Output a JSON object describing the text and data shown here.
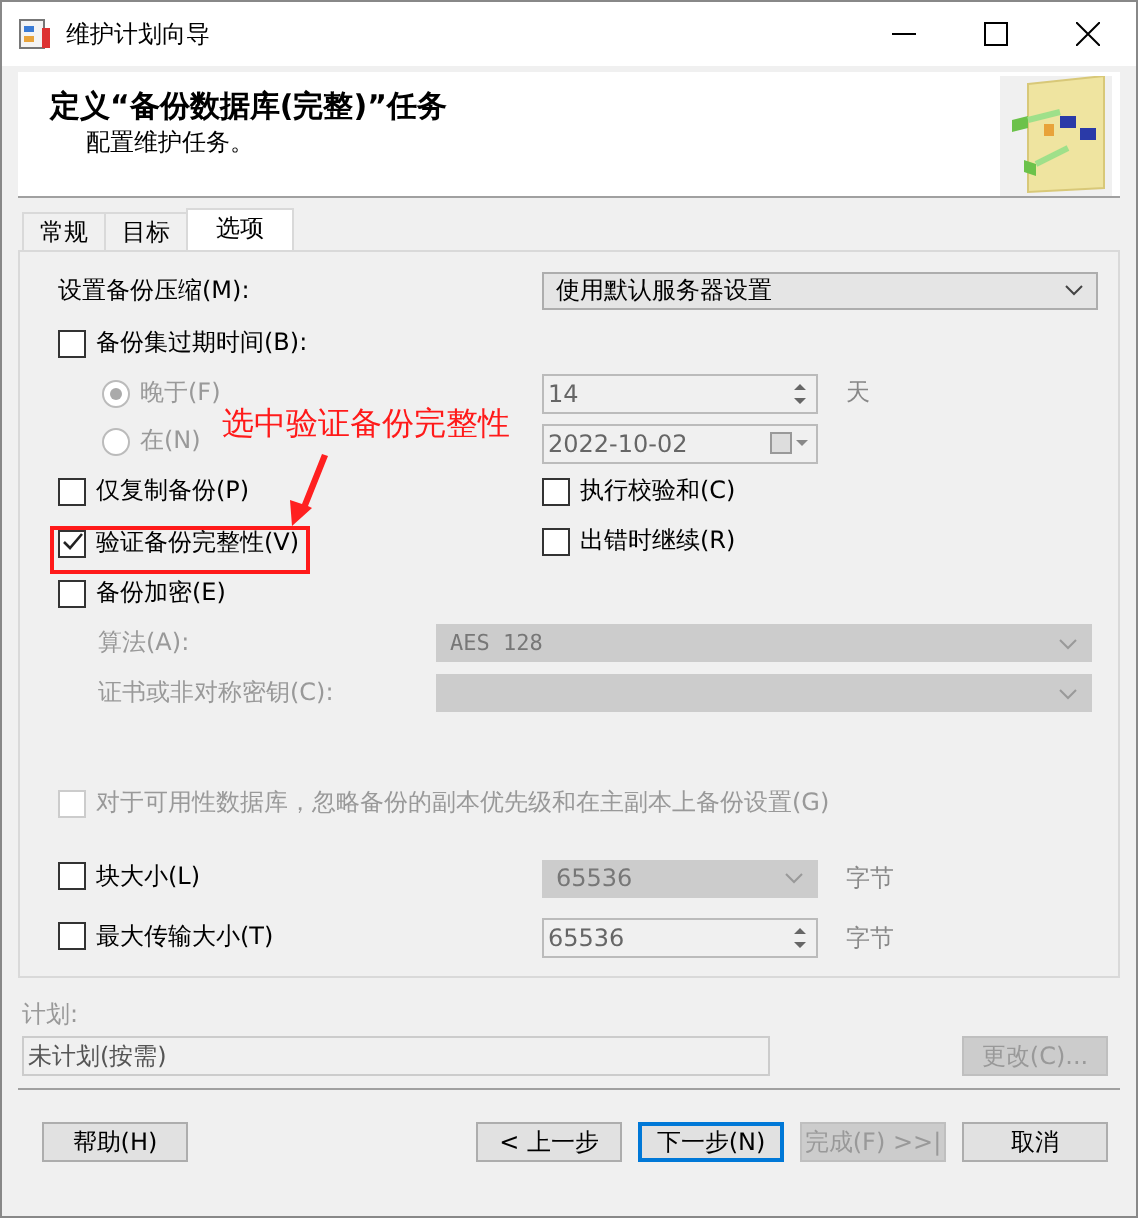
{
  "window": {
    "title": "维护计划向导"
  },
  "header": {
    "title": "定义“备份数据库(完整)”任务",
    "subtitle": "配置维护任务。"
  },
  "tabs": [
    {
      "label": "常规",
      "selected": false
    },
    {
      "label": "目标",
      "selected": false
    },
    {
      "label": "选项",
      "selected": true
    }
  ],
  "compression": {
    "label": "设置备份压缩(M):",
    "value": "使用默认服务器设置"
  },
  "expire": {
    "label": "备份集过期时间(B):",
    "checked": false
  },
  "expire_options": [
    {
      "label": "晚于(F)",
      "selected": true,
      "disabled": true,
      "field": {
        "kind": "spin",
        "value": "14",
        "unit": "天"
      }
    },
    {
      "label": "在(N)",
      "selected": false,
      "disabled": true,
      "field": {
        "kind": "date",
        "value": "2022-10-02"
      }
    }
  ],
  "check_rows": [
    [
      {
        "label": "仅复制备份(P)",
        "checked": false
      },
      {
        "label": "执行校验和(C)",
        "checked": false
      }
    ],
    [
      {
        "label": "验证备份完整性(V)",
        "checked": true
      },
      {
        "label": "出错时继续(R)",
        "checked": false
      }
    ]
  ],
  "encryption": {
    "label": "备份加密(E)",
    "checked": false,
    "fields": [
      {
        "label": "算法(A):",
        "value": "AES 128",
        "disabled": true
      },
      {
        "label": "证书或非对称密钥(C):",
        "disabled": true
      }
    ]
  },
  "availability": {
    "label": "对于可用性数据库，忽略备份的副本优先级和在主副本上备份设置(G)",
    "checked": false,
    "disabled": true
  },
  "sizes": [
    {
      "label": "块大小(L)",
      "checked": false,
      "kind": "combo",
      "value": "65536",
      "unit": "字节"
    },
    {
      "label": "最大传输大小(T)",
      "checked": false,
      "kind": "spin",
      "value": "65536",
      "unit": "字节"
    }
  ],
  "schedule": {
    "label": "计划:",
    "value": "未计划(按需)",
    "button": "更改(C)..."
  },
  "buttons": [
    {
      "label": "帮助(H)",
      "kind": "normal"
    },
    {
      "label": "< 上一步",
      "kind": "normal"
    },
    {
      "label": "下一步(N)",
      "kind": "default"
    },
    {
      "label": "完成(F) >>|",
      "kind": "disabled"
    },
    {
      "label": "取消",
      "kind": "normal"
    }
  ],
  "annotation": {
    "text": "选中验证备份完整性"
  }
}
